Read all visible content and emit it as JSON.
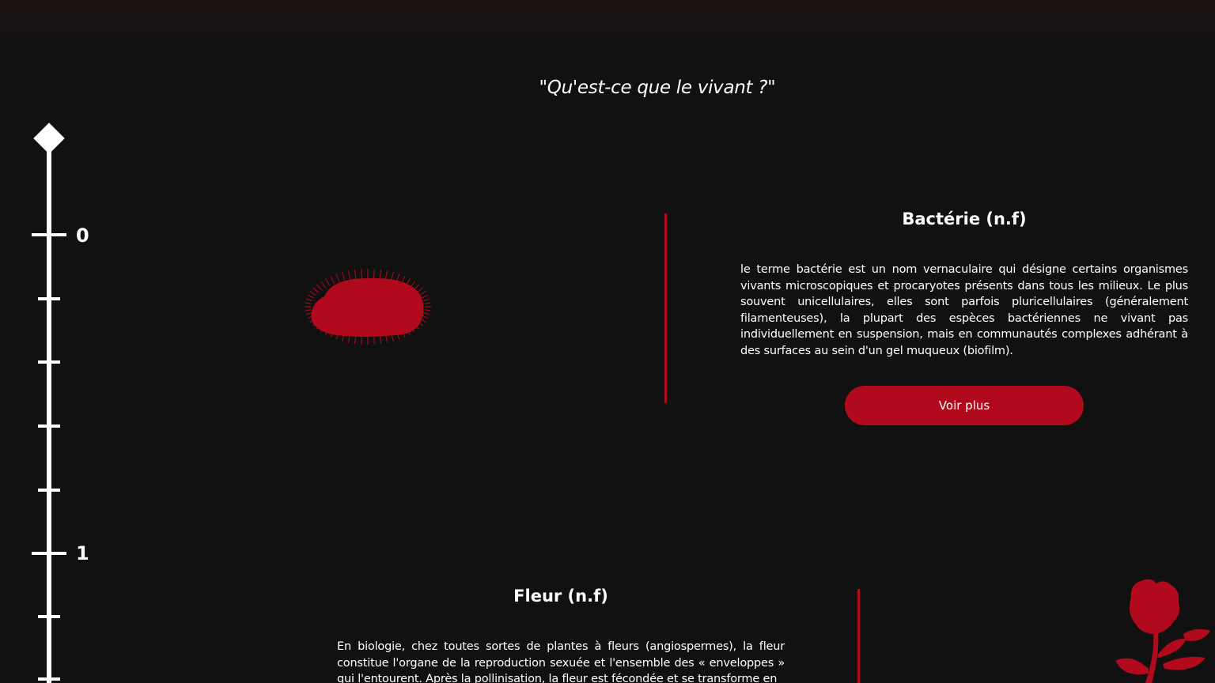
{
  "header": {
    "quote": "\"Qu'est-ce que le vivant ?\""
  },
  "timeline": {
    "labels": [
      "0",
      "1"
    ]
  },
  "sections": [
    {
      "title": "Bactérie (n.f)",
      "text": "le terme bactérie est un nom vernaculaire qui désigne certains organismes vivants microscopiques et procaryotes présents dans tous les milieux. Le plus souvent unicellulaires, elles sont parfois pluricellulaires (généralement filamenteuses), la plupart des espèces bactériennes ne vivant pas individuellement en suspension, mais en communautés complexes adhérant à des surfaces au sein d'un gel muqueux (biofilm).",
      "button_label": "Voir plus",
      "image_icon": "bacteria-icon"
    },
    {
      "title": "Fleur (n.f)",
      "text": "En biologie, chez toutes sortes de plantes à fleurs (angiospermes), la fleur constitue l'organe de la reproduction sexuée et l'ensemble des « enveloppes » qui l'entourent. Après la pollinisation, la fleur est fécondée et se transforme en",
      "image_icon": "rose-icon"
    }
  ],
  "colors": {
    "background": "#111111",
    "accent": "#b20a1d",
    "text": "#ffffff"
  }
}
